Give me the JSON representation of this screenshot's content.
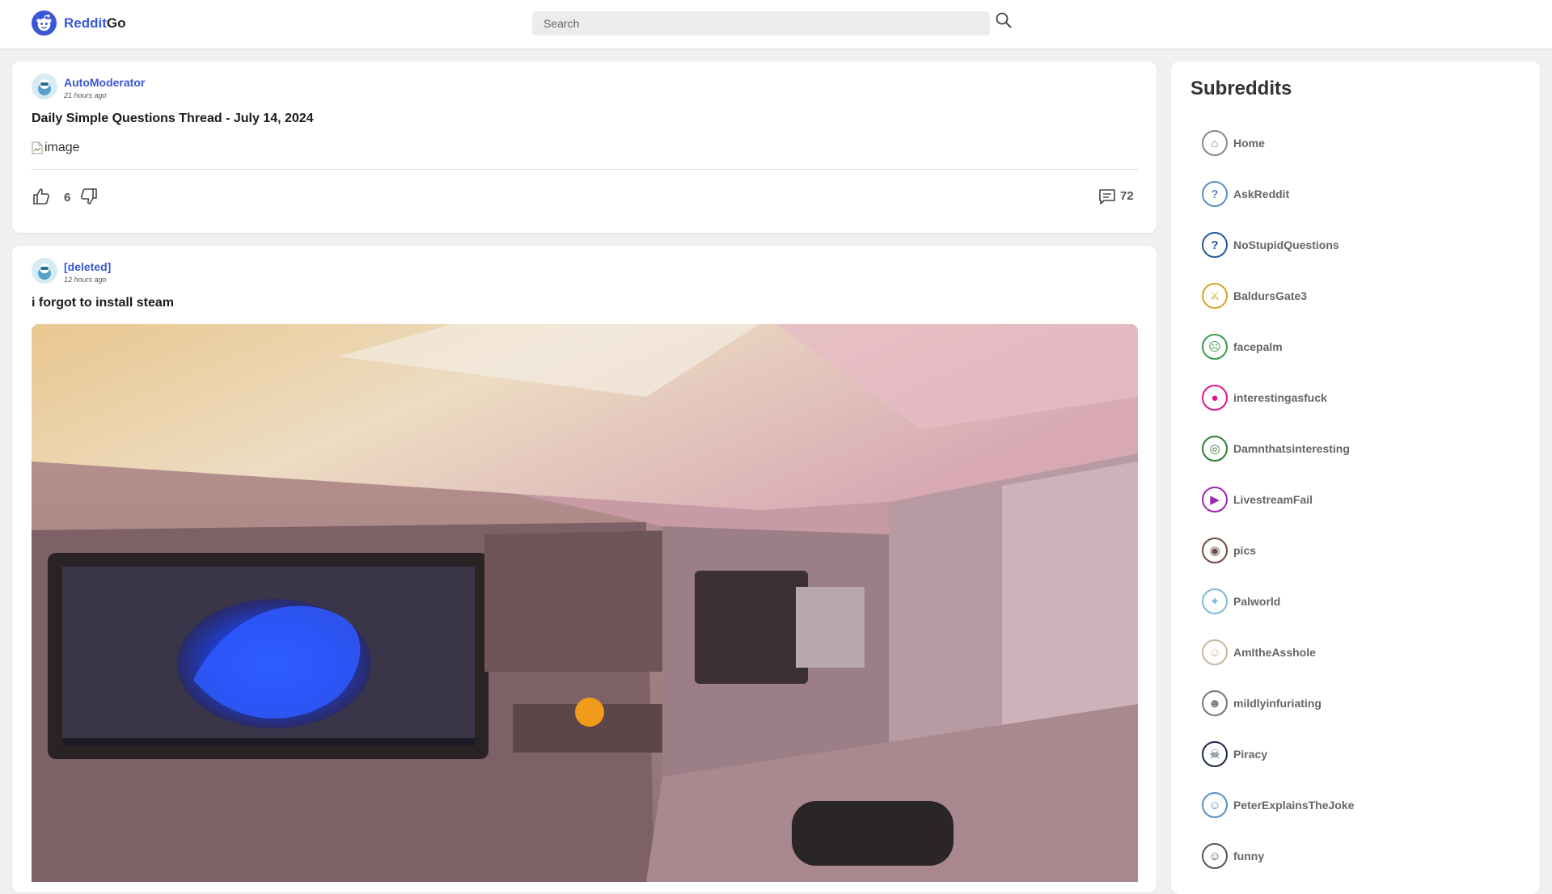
{
  "header": {
    "logo_part1": "Reddit",
    "logo_part2": "Go",
    "search_placeholder": "Search"
  },
  "posts": [
    {
      "author": "AutoModerator",
      "time": "21 hours ago",
      "title": "Daily Simple Questions Thread - July 14, 2024",
      "image_alt": "image",
      "score": "6",
      "comments": "72"
    },
    {
      "author": "[deleted]",
      "time": "12 hours ago",
      "title": "i forgot to install steam"
    }
  ],
  "sidebar": {
    "title": "Subreddits",
    "items": [
      {
        "label": "Home",
        "icon": "home-icon",
        "color": "#8a8a8a"
      },
      {
        "label": "AskReddit",
        "icon": "askreddit-icon",
        "color": "#5b8fc7"
      },
      {
        "label": "NoStupidQuestions",
        "icon": "question-mark-icon",
        "color": "#1f5a9a"
      },
      {
        "label": "BaldursGate3",
        "icon": "baldursgate3-icon",
        "color": "#d4a72c"
      },
      {
        "label": "facepalm",
        "icon": "facepalm-icon",
        "color": "#3a9a50"
      },
      {
        "label": "interestingasfuck",
        "icon": "interestingasfuck-icon",
        "color": "#e0148c"
      },
      {
        "label": "Damnthatsinteresting",
        "icon": "spiral-icon",
        "color": "#2e7d32"
      },
      {
        "label": "LivestreamFail",
        "icon": "livestreamfail-icon",
        "color": "#9c27b0"
      },
      {
        "label": "pics",
        "icon": "pics-icon",
        "color": "#6d4c41"
      },
      {
        "label": "Palworld",
        "icon": "palworld-icon",
        "color": "#7fb9d6"
      },
      {
        "label": "AmItheAsshole",
        "icon": "amitheasshole-icon",
        "color": "#c7b99a"
      },
      {
        "label": "mildlyinfuriating",
        "icon": "mildlyinfuriating-icon",
        "color": "#777777"
      },
      {
        "label": "Piracy",
        "icon": "skull-crossbones-icon",
        "color": "#1d2a44"
      },
      {
        "label": "PeterExplainsTheJoke",
        "icon": "peterexplainsthejoke-icon",
        "color": "#5b8fc7"
      },
      {
        "label": "funny",
        "icon": "funny-icon",
        "color": "#555555"
      }
    ]
  }
}
